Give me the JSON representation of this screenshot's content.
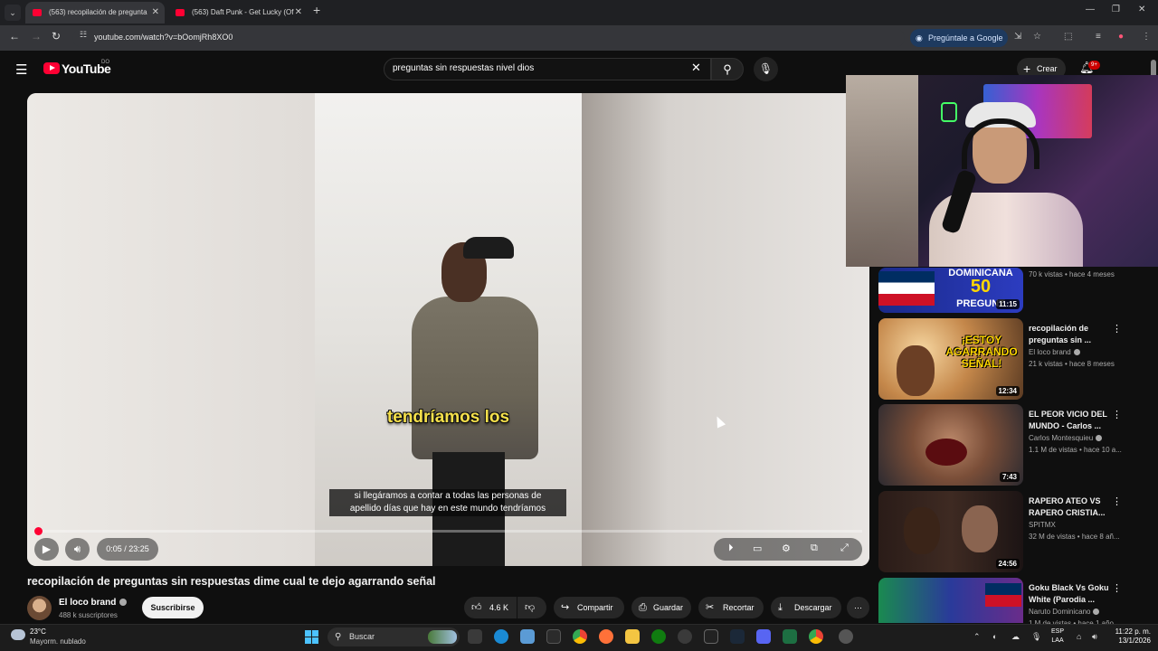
{
  "browser": {
    "tabs": [
      {
        "title": "(563) recopilación de pregunta"
      },
      {
        "title": "(563) Daft Punk - Get Lucky (Of"
      }
    ],
    "url": "youtube.com/watch?v=bOomjRh8XO0",
    "ask_google": "Pregúntale a Google"
  },
  "youtube": {
    "wordmark": "YouTube",
    "country": "DO",
    "search_query": "preguntas sin respuestas nivel dios",
    "create_label": "Crear",
    "notifications": "9+"
  },
  "player": {
    "caption_big": "tendríamos los",
    "cc_line1": "si llegáramos a contar a todas las personas de",
    "cc_line2": "apellido días que hay en este mundo tendríamos",
    "time": "0:05 / 23:25",
    "progress": 0.0036
  },
  "video": {
    "title": "recopilación de preguntas sin respuestas dime cual te dejo agarrando señal",
    "channel": "El loco brand",
    "subscribers": "488 k suscriptores",
    "subscribe_label": "Suscribirse",
    "likes": "4.6 K",
    "share_label": "Compartir",
    "save_label": "Guardar",
    "clip_label": "Recortar",
    "download_label": "Descargar"
  },
  "sidebar": [
    {
      "title": "",
      "channel": "",
      "meta": "70 k vistas • hace 4 meses",
      "duration": "11:15",
      "thumb_text": "DOMINICANA 50 PREGUNT"
    },
    {
      "title": "recopilación de preguntas sin ...",
      "channel": "El loco brand",
      "meta": "21 k vistas • hace 8 meses",
      "duration": "12:34",
      "thumb_text": "¡ESTOY AGARRANDO SEÑAL!"
    },
    {
      "title": "EL PEOR VICIO DEL MUNDO - Carlos ...",
      "channel": "Carlos Montesquieu",
      "meta": "1.1 M de vistas • hace 10 a...",
      "duration": "7:43"
    },
    {
      "title": "RAPERO ATEO VS RAPERO CRISTIA...",
      "channel": "SPITMX",
      "meta": "32 M de vistas • hace 8 añ...",
      "duration": "24:56"
    },
    {
      "title": "Goku Black Vs Goku White (Parodia ...",
      "channel": "Naruto Dominicano",
      "meta": "1 M de vistas • hace 1 año",
      "duration": ""
    }
  ],
  "taskbar": {
    "temperature": "23°C",
    "condition": "Mayorm. nublado",
    "search_label": "Buscar",
    "lang_line1": "ESP",
    "lang_line2": "LAA",
    "time": "11:22 p. m.",
    "date": "13/1/2026"
  },
  "colors": {
    "accent": "#ff0033",
    "background": "#0f0f0f",
    "caption_yellow": "#f5e04b"
  }
}
